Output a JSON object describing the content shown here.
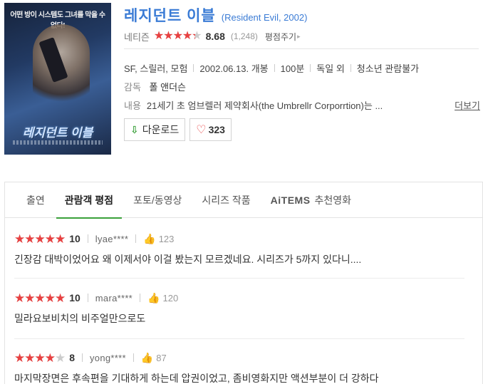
{
  "movie": {
    "title": "레지던트 이블",
    "subtitle": "(Resident Evil, 2002)",
    "rating_source": "네티즌",
    "rating_score": "8.68",
    "rating_count": "(1,248)",
    "rating_fraction": 0.868,
    "rate_label": "평점주기",
    "genre": "SF, 스릴러, 모험",
    "release": "2002.06.13. 개봉",
    "runtime": "100분",
    "country": "독일 외",
    "age": "청소년 관람불가",
    "director_label": "감독",
    "director": "폴 앤더슨",
    "desc_label": "내용",
    "desc": "21세기 초 엄브렐러 제약회사(the Umbrellr Corporrtion)는 ...",
    "more_label": "더보기",
    "download_label": "다운로드",
    "likes": "323",
    "poster_tagline": "어떤 방이 시스템도 그녀를 막을 수 없다!",
    "poster_title": "레지던트 이블"
  },
  "tabs": [
    {
      "label": "출연"
    },
    {
      "label": "관람객 평점"
    },
    {
      "label": "포토/동영상"
    },
    {
      "label": "시리즈 작품"
    },
    {
      "brand": "AiTEMS",
      "label": "추천영화"
    }
  ],
  "reviews": [
    {
      "score": "10",
      "fraction": 1.0,
      "user": "lyae****",
      "likes": "123",
      "text": "긴장감 대박이었어요 왜 이제서야 이걸 봤는지 모르겠네요. 시리즈가 5까지 있다니...."
    },
    {
      "score": "10",
      "fraction": 1.0,
      "user": "mara****",
      "likes": "120",
      "text": "밀라요보비치의 비주얼만으로도"
    },
    {
      "score": "8",
      "fraction": 0.8,
      "user": "yong****",
      "likes": "87",
      "text": "마지막장면은 후속편을 기대하게 하는데 압권이었고, 좀비영화지만 액션부분이 더 강하다"
    }
  ],
  "colors": {
    "accent_blue": "#3a7bd5",
    "star_red": "#e84040",
    "tab_green": "#3aa03a"
  },
  "icons": {
    "download": "download-arrow-icon",
    "heart": "heart-outline-icon",
    "thumb": "thumbs-up-icon",
    "star": "star-icon"
  }
}
